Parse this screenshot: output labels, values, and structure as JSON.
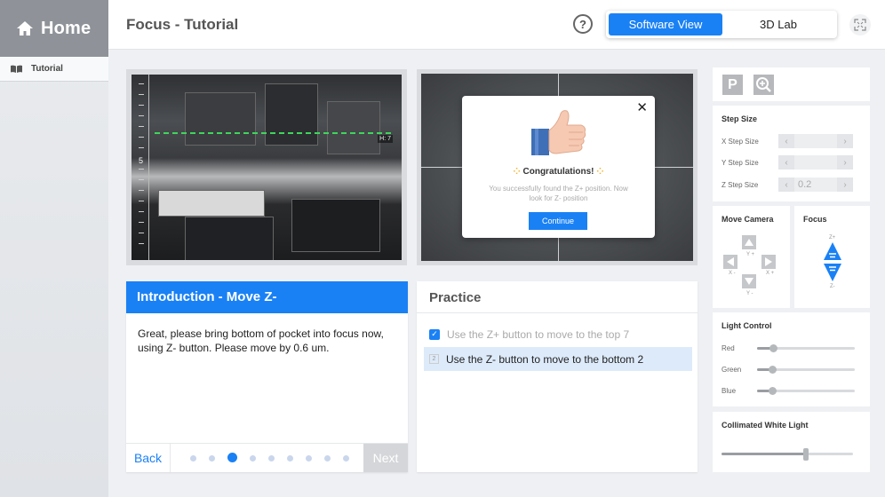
{
  "sidebar": {
    "home_label": "Home",
    "items": [
      {
        "label": "Tutorial"
      }
    ]
  },
  "header": {
    "title": "Focus - Tutorial",
    "help": "?",
    "views": [
      {
        "label": "Software View",
        "active": true
      },
      {
        "label": "3D Lab",
        "active": false
      }
    ]
  },
  "camera_left": {
    "ruler_mark": "5",
    "height_label": "H: 7"
  },
  "modal": {
    "congrats": "Congratulations!",
    "message": "You successfully found the Z+ position. Now look for Z- position",
    "button": "Continue"
  },
  "intro": {
    "title": "Introduction - Move Z-",
    "body": "Great, please bring bottom of pocket into focus now, using Z- button. Please move by 0.6 um.",
    "back": "Back",
    "next": "Next",
    "steps_total": 9,
    "step_current": 3
  },
  "practice": {
    "title": "Practice",
    "tasks": [
      {
        "label": "Use the Z+ button to move to the top 7",
        "done": true
      },
      {
        "number": "2",
        "label": "Use the Z- button to move to the bottom 2",
        "done": false
      }
    ]
  },
  "tools": {
    "p_label": "P"
  },
  "step_size": {
    "title": "Step Size",
    "x_label": "X Step Size",
    "x_value": "",
    "y_label": "Y Step Size",
    "y_value": "",
    "z_label": "Z Step Size",
    "z_value": "0.2"
  },
  "move_camera": {
    "title": "Move Camera",
    "y_plus": "Y +",
    "y_minus": "Y -",
    "x_minus": "X -",
    "x_plus": "X +"
  },
  "focus": {
    "title": "Focus",
    "z_plus": "Z+",
    "z_minus": "Z-",
    "accent": "#1a81f5"
  },
  "light_control": {
    "title": "Light Control",
    "red_label": "Red",
    "red_value": 0.17,
    "green_label": "Green",
    "green_value": 0.16,
    "blue_label": "Blue",
    "blue_value": 0.16
  },
  "collimated": {
    "title": "Collimated White Light",
    "value": 0.64
  }
}
